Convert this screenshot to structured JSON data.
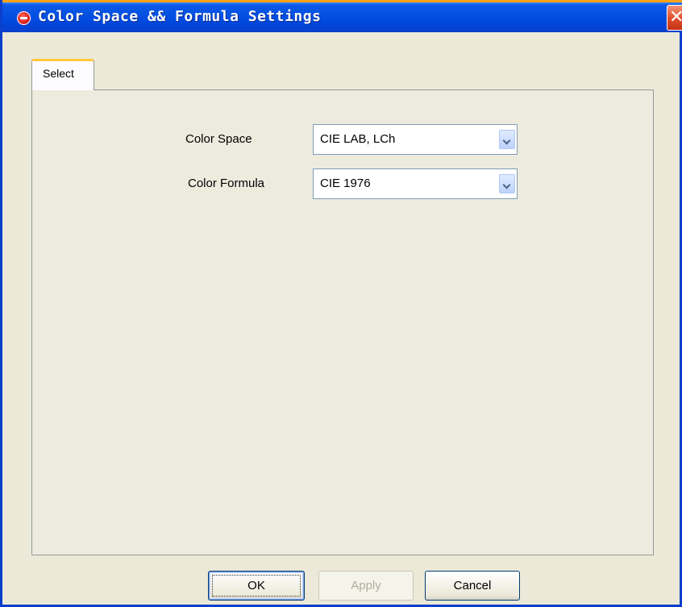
{
  "window": {
    "title": "Color Space && Formula Settings",
    "close_label": "✕"
  },
  "tabs": [
    {
      "label": "Select",
      "active": true
    }
  ],
  "form": {
    "color_space": {
      "label": "Color Space",
      "value": "CIE LAB, LCh"
    },
    "color_formula": {
      "label": "Color Formula",
      "value": "CIE 1976"
    }
  },
  "buttons": {
    "ok": "OK",
    "apply": "Apply",
    "cancel": "Cancel"
  },
  "colors": {
    "titlebar": "#0551e3",
    "background": "#ece9d8",
    "close": "#e1512d"
  }
}
